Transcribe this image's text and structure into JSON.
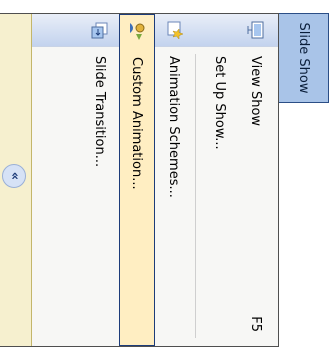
{
  "menu": {
    "title": "Slide Show",
    "items": [
      {
        "label": "View Show",
        "shortcut": "F5",
        "icon": "projector-screen-icon"
      },
      {
        "label": "Set Up Show...",
        "shortcut": "",
        "icon": ""
      },
      {
        "label": "Animation Schemes...",
        "shortcut": "",
        "icon": "star-animation-icon"
      },
      {
        "label": "Custom Animation...",
        "shortcut": "",
        "icon": "custom-animation-icon"
      },
      {
        "label": "Slide Transition...",
        "shortcut": "",
        "icon": "slide-transition-icon"
      }
    ],
    "expand_glyph": "«"
  }
}
